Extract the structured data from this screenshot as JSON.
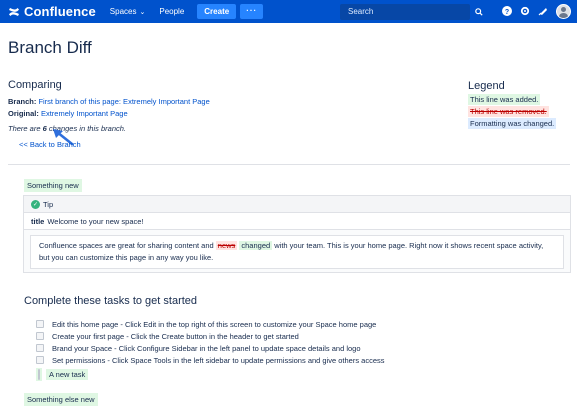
{
  "nav": {
    "brand": "Confluence",
    "spaces": "Spaces",
    "people": "People",
    "create": "Create",
    "more": "···",
    "search_placeholder": "Search"
  },
  "page": {
    "title": "Branch Diff",
    "comparing_heading": "Comparing",
    "branch_label": "Branch:",
    "branch_link": "First branch of this page: Extremely Important Page",
    "original_label": "Original:",
    "original_link": "Extremely Important Page",
    "changes_prefix": "There are ",
    "changes_count": "6",
    "changes_suffix": " changes in this branch.",
    "back_link": "<< Back to Branch"
  },
  "legend": {
    "heading": "Legend",
    "added": "This line was added.",
    "removed": "This line was removed.",
    "changed": "Formatting was changed."
  },
  "diff": {
    "something_new": "Something new",
    "tip_label": "Tip",
    "title_label": "title",
    "title_value": "Welcome to your new space!",
    "body_before": "Confluence spaces are great for sharing content and ",
    "body_removed": "news",
    "body_added": "changed",
    "body_after": " with your team. This is your home page. Right now it shows recent space activity, but you can customize this page in any way you like.",
    "tasks_heading": "Complete these tasks to get started",
    "tasks": [
      "Edit this home page - Click Edit in the top right of this screen to customize your Space home page",
      "Create your first page - Click the Create button in the header to get started",
      "Brand your Space - Click Configure Sidebar in the left panel to update space details and logo",
      "Set permissions - Click Space Tools in the left sidebar to update permissions and give others access"
    ],
    "new_task": "A new task",
    "something_else_new": "Something else new"
  },
  "colors": {
    "nav_bg": "#0052cc",
    "create_bg": "#2684ff",
    "added_bg": "#dff7e3",
    "removed_bg": "#ffe3e0",
    "changed_bg": "#dcebff",
    "link": "#0052cc"
  }
}
